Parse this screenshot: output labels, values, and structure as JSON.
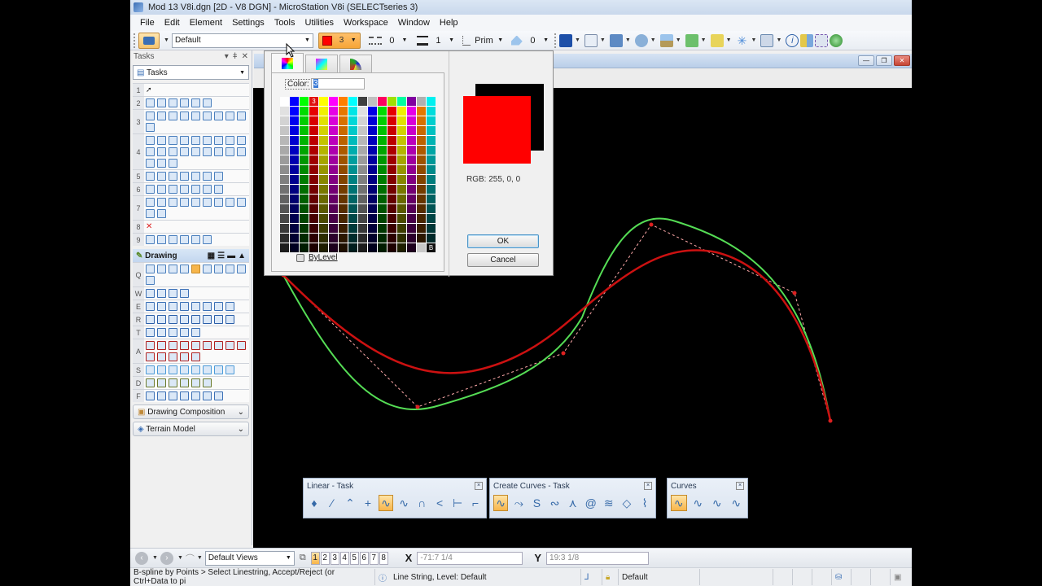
{
  "window": {
    "title": "Mod 13  V8i.dgn [2D - V8 DGN] - MicroStation V8i (SELECTseries 3)"
  },
  "menu": [
    "File",
    "Edit",
    "Element",
    "Settings",
    "Tools",
    "Utilities",
    "Workspace",
    "Window",
    "Help"
  ],
  "attributes_toolbar": {
    "level": "Default",
    "color_value": "3",
    "color_swatch": "#ff0000",
    "style_value": "0",
    "weight_value": "1",
    "class_value": "Prim",
    "transparency_value": "0"
  },
  "toolbar_icons": [
    "element-selection-icon",
    "new-file-icon",
    "models-icon",
    "references-icon",
    "raster-icon",
    "level-manager-icon",
    "level-display-icon",
    "zoom-icon",
    "snap-icon",
    "info-icon",
    "key-in-icon",
    "accudraw-icon",
    "render-icon"
  ],
  "tasks_panel": {
    "title": "Tasks",
    "selected_task": "Tasks",
    "groups": [
      {
        "num": "1",
        "count": 1
      },
      {
        "num": "2",
        "count": 6
      },
      {
        "num": "3",
        "count": 10
      },
      {
        "num": "4",
        "count": 21
      },
      {
        "num": "5",
        "count": 7
      },
      {
        "num": "6",
        "count": 7
      },
      {
        "num": "7",
        "count": 11
      },
      {
        "num": "8",
        "count": 1
      },
      {
        "num": "9",
        "count": 6
      }
    ],
    "drawing": {
      "title": "Drawing",
      "rows": [
        {
          "key": "Q",
          "count": 10
        },
        {
          "key": "W",
          "count": 4
        },
        {
          "key": "E",
          "count": 8
        },
        {
          "key": "R",
          "count": 8
        },
        {
          "key": "T",
          "count": 5
        },
        {
          "key": "A",
          "count": 14
        },
        {
          "key": "S",
          "count": 8
        },
        {
          "key": "D",
          "count": 6
        },
        {
          "key": "F",
          "count": 7
        }
      ]
    },
    "collapsed_sections": [
      "Drawing Composition",
      "Terrain Model"
    ]
  },
  "color_dialog": {
    "tabs": [
      "color-table-tab",
      "color-gradient-tab",
      "color-book-tab"
    ],
    "color_label": "Color:",
    "color_value": "3",
    "selected_index_label": "3",
    "bg_cell_label": "B",
    "bylevel_label": "ByLevel",
    "rgb_text": "RGB: 255, 0, 0",
    "preview_color": "#ff0000",
    "ok_label": "OK",
    "cancel_label": "Cancel"
  },
  "float_toolbars": [
    {
      "title": "Linear - Task",
      "icons": [
        "place-smartline",
        "place-line",
        "place-multi-line",
        "place-point",
        "place-bspline-curve",
        "place-stream-curve",
        "place-curve",
        "construct-bisector",
        "construct-line-aa",
        "place-line-by-points"
      ],
      "selected": 4
    },
    {
      "title": "Create Curves - Task",
      "icons": [
        "bspline-curve",
        "interpolate-curve",
        "composite-curve",
        "convert-to-bspline",
        "construct-tangent",
        "place-spiral",
        "place-helix",
        "surface-curve",
        "create-curve-graph"
      ],
      "selected": 0
    },
    {
      "title": "Curves",
      "icons": [
        "create-curves",
        "modify-curves",
        "change-curves",
        "analyze-curves"
      ],
      "selected": 0
    }
  ],
  "view_bar": {
    "views_select": "Default Views",
    "view_numbers": [
      "1",
      "2",
      "3",
      "4",
      "5",
      "6",
      "7",
      "8"
    ],
    "active_view": "1",
    "x_label": "X",
    "x_value": "-71:7 1/4",
    "y_label": "Y",
    "y_value": "19:3 1/8"
  },
  "status_bar": {
    "prompt": "B-spline by Points > Select Linestring, Accept/Reject (or Ctrl+Data to pi",
    "message": "Line String, Level: Default",
    "level": "Default"
  },
  "drawing_canvas": {
    "control_points": [
      [
        513,
        500
      ],
      [
        692,
        434
      ],
      [
        800,
        276
      ],
      [
        976,
        360
      ],
      [
        1020,
        517
      ]
    ],
    "colors": {
      "bspline": "#cc1111",
      "interpolated": "#55dd55",
      "polygon": "#ffaaaa"
    }
  }
}
